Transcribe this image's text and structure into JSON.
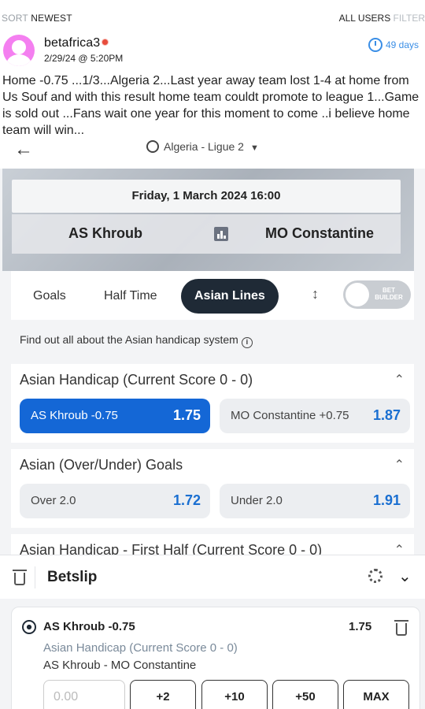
{
  "topbar": {
    "sort_label": "SORT",
    "sort_value": "NEWEST",
    "all_users": "ALL USERS",
    "filter": "FILTER"
  },
  "post": {
    "username": "betafrica3",
    "date": "2/29/24 @ 5:20PM",
    "ago": "49 days",
    "text": "Home -0.75 ...1/3...Algeria 2...Last year away team lost 1-4 at home from Us Souf and with this result home team couldt promote to league 1...Game is sold out ...Fans wait one year for this moment to come ..i believe home team will win..."
  },
  "app": {
    "league": "Algeria - Ligue 2",
    "match_date": "Friday, 1 March 2024 16:00",
    "home": "AS Khroub",
    "away": "MO Constantine",
    "tabs": [
      "Goals",
      "Half Time",
      "Asian Lines"
    ],
    "active_tab": "Asian Lines",
    "toggle_label": "BET BUILDER",
    "info": "Find out all about the Asian handicap system",
    "markets": [
      {
        "title": "Asian Handicap (Current Score 0 - 0)",
        "odds": [
          {
            "sel": "AS Khroub -0.75",
            "price": "1.75",
            "selected": true
          },
          {
            "sel": "MO Constantine +0.75",
            "price": "1.87",
            "selected": false
          }
        ]
      },
      {
        "title": "Asian (Over/Under) Goals",
        "odds": [
          {
            "sel": "Over 2.0",
            "price": "1.72",
            "selected": false
          },
          {
            "sel": "Under 2.0",
            "price": "1.91",
            "selected": false
          }
        ]
      },
      {
        "title": "Asian Handicap - First Half (Current Score 0 - 0)"
      }
    ],
    "betslip": {
      "title": "Betslip",
      "selection": "AS Khroub -0.75",
      "price": "1.75",
      "market": "Asian Handicap (Current Score 0 - 0)",
      "match": "AS Khroub - MO Constantine",
      "stake_placeholder": "0.00",
      "quick": [
        "+2",
        "+10",
        "+50",
        "MAX"
      ]
    }
  },
  "colors": {
    "accent": "#1467d6",
    "dark": "#1f2a36",
    "link": "#3a8ee6",
    "avatar": "#f47ff0"
  }
}
